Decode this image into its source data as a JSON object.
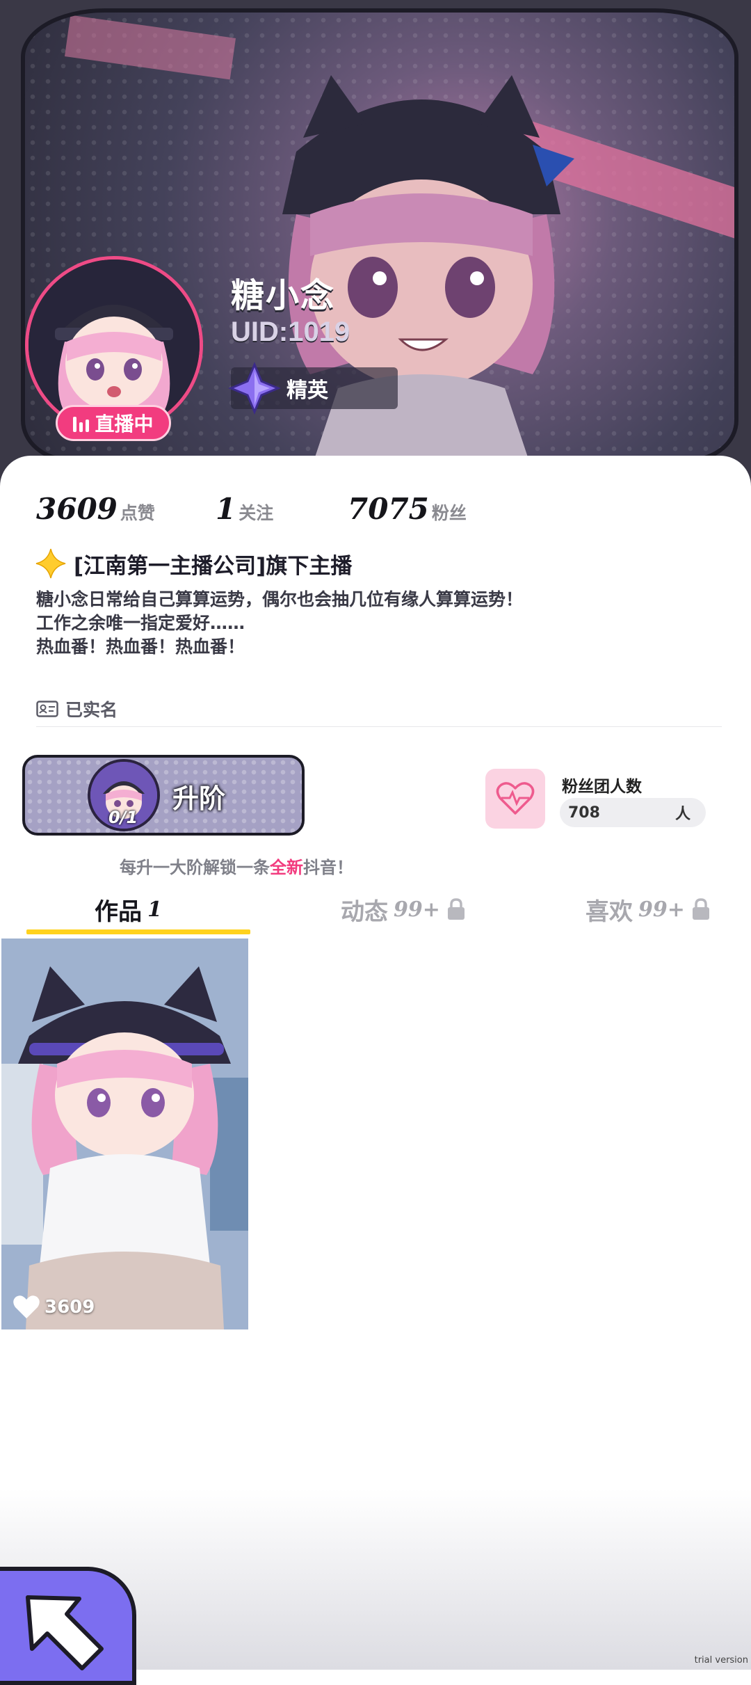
{
  "profile": {
    "name": "糖小念",
    "uid": "UID:1019",
    "live_badge": "直播中",
    "rank": "精英"
  },
  "stats": [
    {
      "value": "3609",
      "label": "点赞"
    },
    {
      "value": "1",
      "label": "关注"
    },
    {
      "value": "7075",
      "label": "粉丝"
    }
  ],
  "company": "[江南第一主播公司]旗下主播",
  "bio": [
    "糖小念日常给自己算算运势，偶尔也会抽几位有缘人算算运势！",
    "工作之余唯一指定爱好……",
    "热血番！热血番！热血番！"
  ],
  "verified": "已实名",
  "levelup": {
    "label": "升阶",
    "progress": "0/1"
  },
  "fan_group": {
    "title": "粉丝团人数",
    "count": "708",
    "unit": "人"
  },
  "hint": {
    "prefix": "每升一大阶解锁一条",
    "highlight": "全新",
    "suffix": "抖音！"
  },
  "tabs": [
    {
      "label": "作品",
      "count": "1",
      "locked": false
    },
    {
      "label": "动态",
      "count": "99+",
      "locked": true
    },
    {
      "label": "喜欢",
      "count": "99+",
      "locked": true
    }
  ],
  "works": [
    {
      "likes": "3609"
    }
  ],
  "watermark": "trial version",
  "colors": {
    "accent": "#f23c7f",
    "tab_underline": "#ffd21e",
    "fab": "#7c6ef0"
  }
}
